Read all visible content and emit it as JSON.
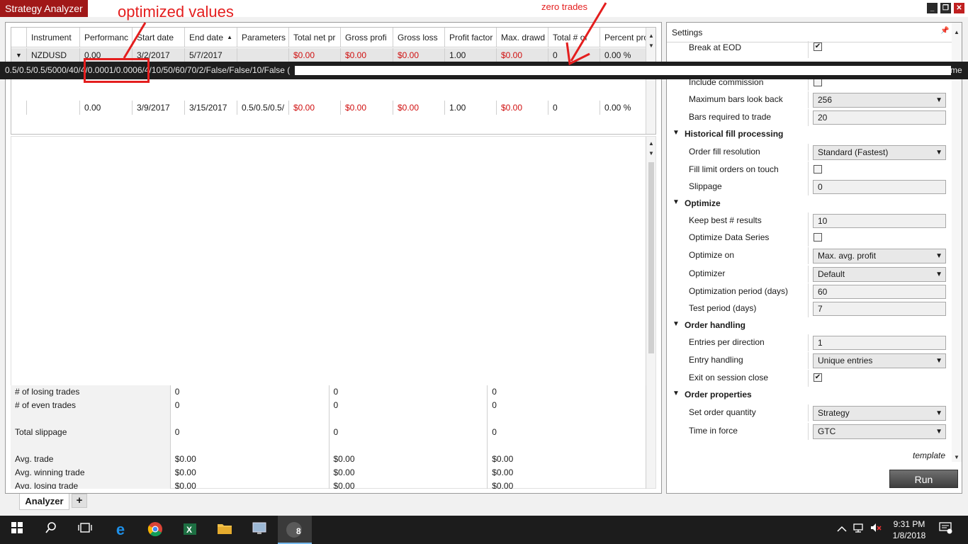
{
  "window": {
    "title": "Strategy Analyzer",
    "minimize": "_",
    "restore": "❐",
    "close": "✕"
  },
  "annotations": {
    "optimized": "optimized values",
    "zero_trades": "zero trades"
  },
  "grid": {
    "columns": [
      "Instrument",
      "Performanc",
      "Start date",
      "End date",
      "Parameters",
      "Total net pr",
      "Gross profi",
      "Gross loss",
      "Profit factor",
      "Max. drawd",
      "Total # of",
      "Percent pro"
    ],
    "rows": [
      {
        "instrument": "NZDUSD",
        "performance": "0.00",
        "start": "3/2/2017",
        "end": "5/7/2017",
        "params": "",
        "net": "$0.00",
        "gp": "$0.00",
        "gl": "$0.00",
        "pf": "1.00",
        "dd": "$0.00",
        "trades": "0",
        "pct": "0.00 %"
      },
      {
        "instrument": "",
        "performance": "0.00",
        "start": "3/9/2017",
        "end": "3/15/2017",
        "params": "0.5/0.5/0.5/",
        "net": "$0.00",
        "gp": "$0.00",
        "gl": "$0.00",
        "pf": "1.00",
        "dd": "$0.00",
        "trades": "0",
        "pct": "0.00 %"
      }
    ]
  },
  "tooltip": {
    "text": "0.5/0.5/0.5/5000/40/4/0.0001/0.0006/4/10/50/60/70/2/False/False/10/False (",
    "tail": "me"
  },
  "stats": {
    "rows": [
      {
        "label": "# of losing trades",
        "v1": "0",
        "v2": "0",
        "v3": "0"
      },
      {
        "label": "# of even trades",
        "v1": "0",
        "v2": "0",
        "v3": "0"
      },
      {
        "label": "Total slippage",
        "v1": "0",
        "v2": "0",
        "v3": "0"
      },
      {
        "label": "Avg. trade",
        "v1": "$0.00",
        "v2": "$0.00",
        "v3": "$0.00"
      },
      {
        "label": "Avg. winning trade",
        "v1": "$0.00",
        "v2": "$0.00",
        "v3": "$0.00"
      },
      {
        "label": "Avg. losing trade",
        "v1": "$0.00",
        "v2": "$0.00",
        "v3": "$0.00"
      }
    ]
  },
  "settings": {
    "title": "Settings",
    "break_at_eod": "Break at EOD",
    "include_commission": "Include commission",
    "max_bars_label": "Maximum bars look back",
    "max_bars_value": "256",
    "bars_req_label": "Bars required to trade",
    "bars_req_value": "20",
    "hist_fill_cat": "Historical fill processing",
    "order_fill_res_label": "Order fill resolution",
    "order_fill_res_value": "Standard (Fastest)",
    "fill_limit_label": "Fill limit orders on touch",
    "slippage_label": "Slippage",
    "slippage_value": "0",
    "optimize_cat": "Optimize",
    "keep_best_label": "Keep best # results",
    "keep_best_value": "10",
    "opt_data_series_label": "Optimize Data Series",
    "optimize_on_label": "Optimize on",
    "optimize_on_value": "Max. avg. profit",
    "optimizer_label": "Optimizer",
    "optimizer_value": "Default",
    "opt_period_label": "Optimization period (days)",
    "opt_period_value": "60",
    "test_period_label": "Test period (days)",
    "test_period_value": "7",
    "order_handling_cat": "Order handling",
    "entries_label": "Entries per direction",
    "entries_value": "1",
    "entry_handling_label": "Entry handling",
    "entry_handling_value": "Unique entries",
    "exit_session_label": "Exit on session close",
    "order_props_cat": "Order properties",
    "set_qty_label": "Set order quantity",
    "set_qty_value": "Strategy",
    "tif_label": "Time in force",
    "tif_value": "GTC",
    "template": "template",
    "run": "Run"
  },
  "tabs": {
    "analyzer": "Analyzer",
    "add": "+"
  },
  "taskbar": {
    "time": "9:31 PM",
    "date": "1/8/2018",
    "ninja_badge": "8"
  }
}
